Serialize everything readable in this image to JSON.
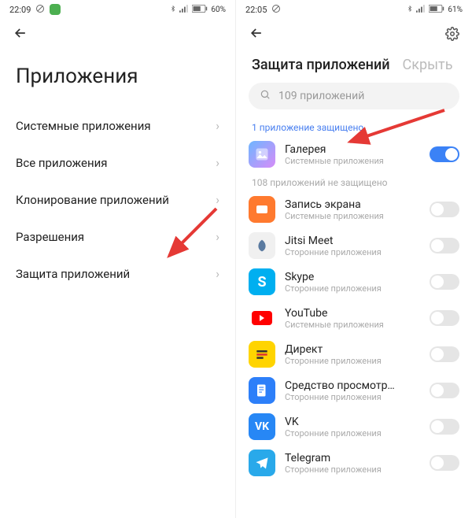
{
  "left": {
    "status": {
      "time": "22:09",
      "battery": "60%"
    },
    "title": "Приложения",
    "menu": [
      {
        "label": "Системные приложения"
      },
      {
        "label": "Все приложения"
      },
      {
        "label": "Клонирование приложений"
      },
      {
        "label": "Разрешения"
      },
      {
        "label": "Защита приложений"
      }
    ]
  },
  "right": {
    "status": {
      "time": "22:05",
      "battery": "61%"
    },
    "tabs": {
      "active": "Защита приложений",
      "inactive": "Скрыть"
    },
    "search_placeholder": "109 приложений",
    "section_protected": "1 приложение защищено",
    "section_unprotected": "108 приложений не защищено",
    "system_label": "Системные приложения",
    "thirdparty_label": "Сторонние приложения",
    "apps_protected": [
      {
        "name": "Галерея",
        "type": "system",
        "on": true,
        "icon": "gallery"
      }
    ],
    "apps_unprotected": [
      {
        "name": "Запись экрана",
        "type": "system",
        "on": false,
        "icon": "record"
      },
      {
        "name": "Jitsi Meet",
        "type": "thirdparty",
        "on": false,
        "icon": "jitsi"
      },
      {
        "name": "Skype",
        "type": "thirdparty",
        "on": false,
        "icon": "skype"
      },
      {
        "name": "YouTube",
        "type": "system",
        "on": false,
        "icon": "youtube"
      },
      {
        "name": "Директ",
        "type": "thirdparty",
        "on": false,
        "icon": "direct"
      },
      {
        "name": "Средство просмотр…",
        "type": "thirdparty",
        "on": false,
        "icon": "viewer"
      },
      {
        "name": "VK",
        "type": "thirdparty",
        "on": false,
        "icon": "vk"
      },
      {
        "name": "Telegram",
        "type": "thirdparty",
        "on": false,
        "icon": "telegram"
      }
    ]
  }
}
